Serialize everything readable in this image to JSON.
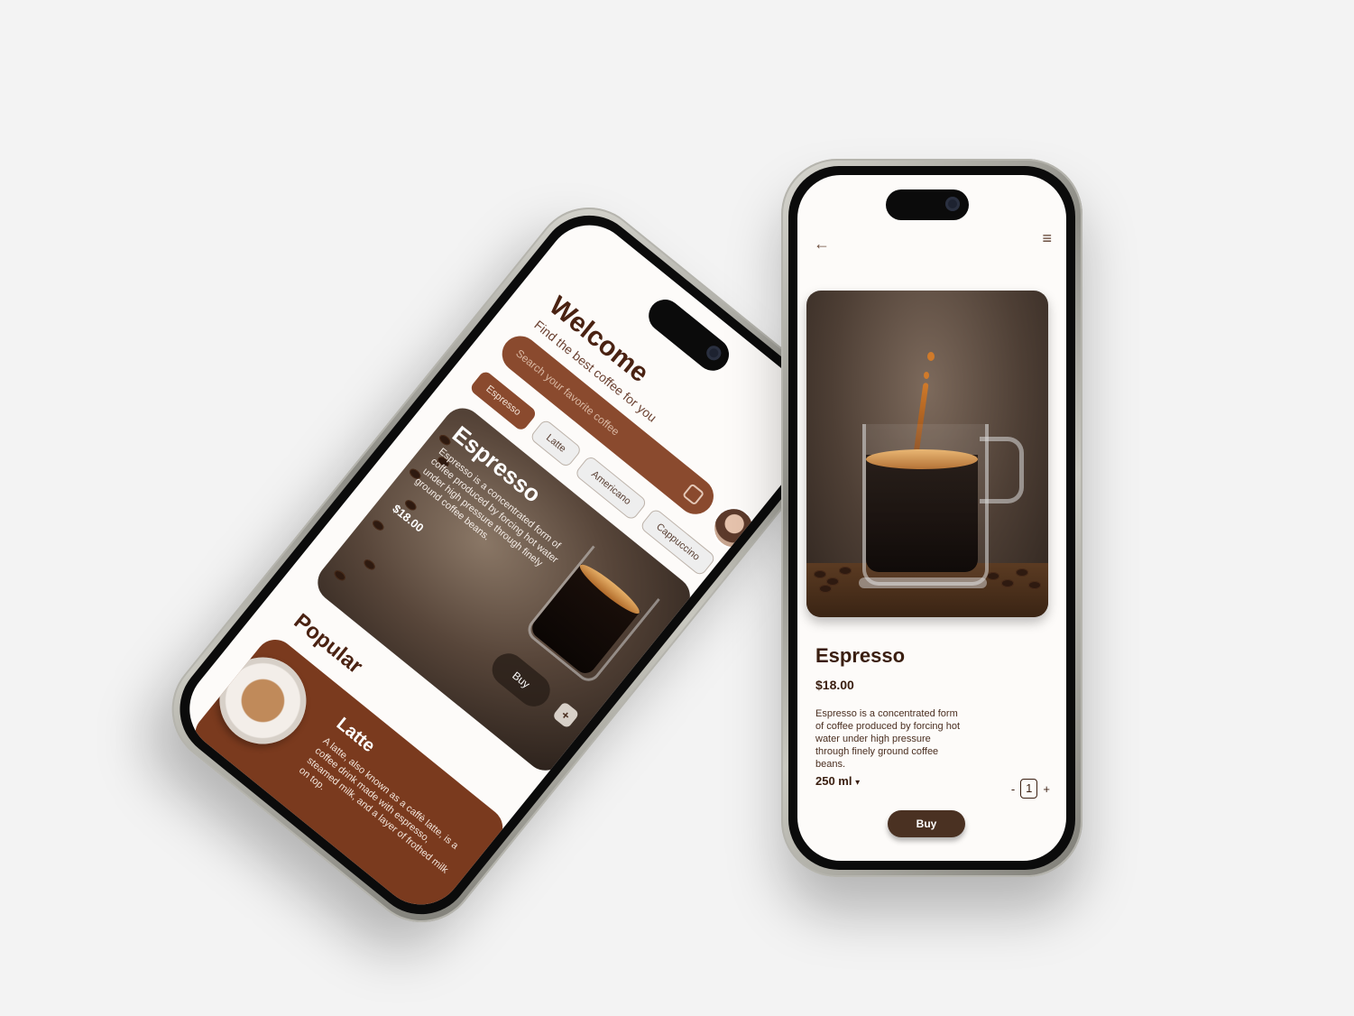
{
  "home": {
    "welcome": "Welcome",
    "subtitle": "Find the best coffee for you",
    "search_placeholder": "Search your favorite coffee",
    "chips": [
      "Espresso",
      "Latte",
      "Americano",
      "Cappuccino"
    ],
    "featured": {
      "title": "Espresso",
      "description": "Espresso is a concentrated form of coffee produced by forcing hot water under high pressure through finely ground coffee beans.",
      "price": "$18.00",
      "buy_label": "Buy",
      "add_label": "+"
    },
    "popular_heading": "Popular",
    "popular_item": {
      "title": "Latte",
      "description": "A latte, also known as a caffè latte, is a coffee drink made with espresso, steamed milk, and a layer of frothed milk on top."
    }
  },
  "detail": {
    "back_icon": "←",
    "menu_icon": "≡",
    "title": "Espresso",
    "price": "$18.00",
    "description": "Espresso is a concentrated form of coffee produced by forcing hot water under high pressure through finely ground coffee beans.",
    "size": "250 ml",
    "size_caret": "▾",
    "qty_minus": "-",
    "qty_value": "1",
    "qty_plus": "+",
    "buy_label": "Buy"
  },
  "colors": {
    "brand_brown": "#8a4a2e",
    "dark_brown": "#4a3122",
    "popular_card": "#7a3a1e"
  }
}
